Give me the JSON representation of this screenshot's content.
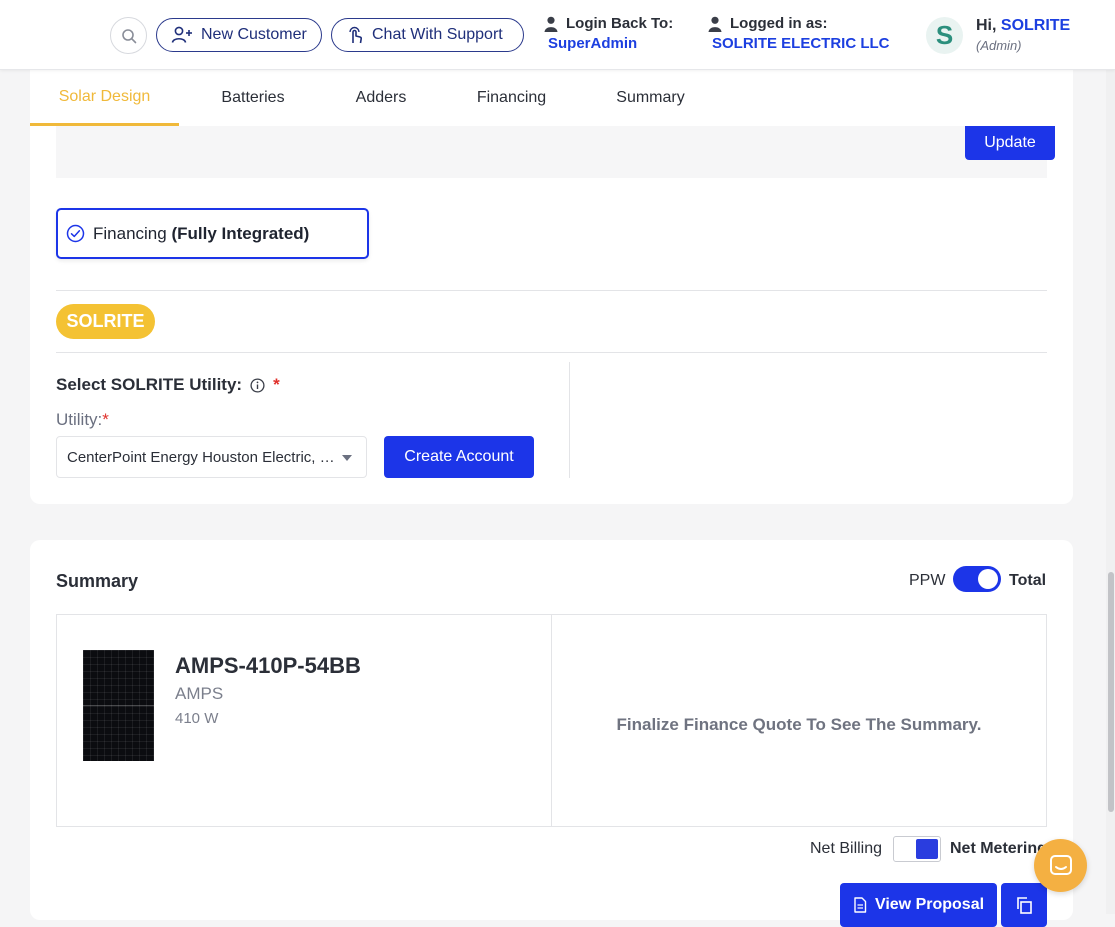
{
  "header": {
    "new_customer": "New Customer",
    "chat_support": "Chat With Support",
    "login_back_label": "Login Back To:",
    "login_back_value": "SuperAdmin",
    "logged_in_label": "Logged in as:",
    "logged_in_value": "SOLRITE ELECTRIC LLC",
    "avatar_letter": "S",
    "greeting": "Hi, ",
    "user_name": "SOLRITE",
    "role": "(Admin)"
  },
  "tabs": [
    {
      "label": "Solar Design",
      "active": true
    },
    {
      "label": "Batteries",
      "active": false
    },
    {
      "label": "Adders",
      "active": false
    },
    {
      "label": "Financing",
      "active": false
    },
    {
      "label": "Summary",
      "active": false
    }
  ],
  "financing": {
    "update_label": "Update",
    "option_label": "Financing",
    "option_bold": "(Fully Integrated)",
    "badge": "SOLRITE",
    "utility_title": "Select SOLRITE Utility:",
    "required_mark": "*",
    "utility_label": "Utility:",
    "utility_value": "CenterPoint Energy Houston Electric, LLC",
    "create_account": "Create Account"
  },
  "summary": {
    "title": "Summary",
    "ppw": "PPW",
    "total": "Total",
    "product_name": "AMPS-410P-54BB",
    "product_brand": "AMPS",
    "product_watt": "410 W",
    "finalize_msg": "Finalize Finance Quote To See The Summary.",
    "net_billing": "Net Billing",
    "net_metering": "Net Metering",
    "view_proposal": "View Proposal"
  },
  "colors": {
    "accent": "#1c35e8",
    "tab_active": "#f0b93a",
    "badge": "#f4c233",
    "chat_widget": "#f4b042"
  }
}
